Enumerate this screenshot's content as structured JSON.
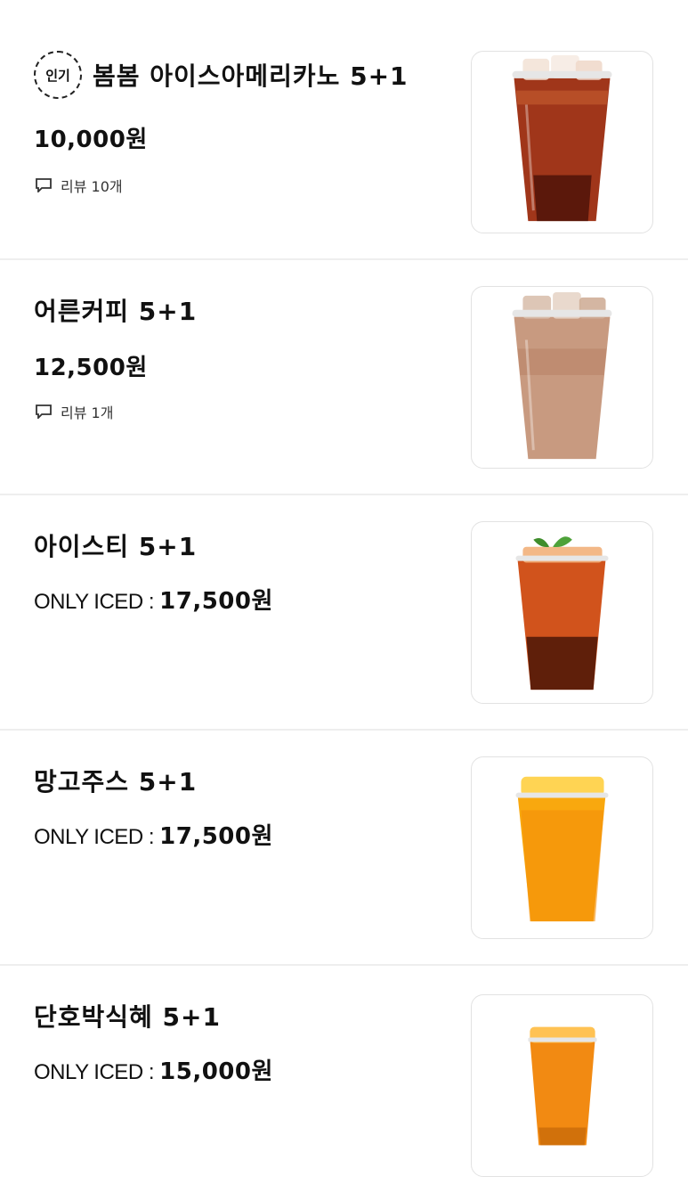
{
  "items": [
    {
      "name": "봄봄 아이스아메리카노 5+1",
      "badge": "인기",
      "price": "10,000원",
      "review": "리뷰 10개",
      "image": "iced-americano-cup"
    },
    {
      "name": "어른커피 5+1",
      "price": "12,500원",
      "review": "리뷰 1개",
      "image": "iced-latte-cup"
    },
    {
      "name": "아이스티 5+1",
      "price_label": "ONLY ICED : ",
      "price": "17,500원",
      "image": "iced-tea-cup"
    },
    {
      "name": "망고주스 5+1",
      "price_label": "ONLY ICED : ",
      "price": "17,500원",
      "image": "mango-juice-cup"
    },
    {
      "name": "단호박식혜 5+1",
      "price_label": "ONLY ICED : ",
      "price": "15,000원",
      "image": "pumpkin-sikhye-cup"
    }
  ],
  "icons": {
    "review": "speech-bubble-icon",
    "badge": "dashed-circle-icon"
  },
  "colors": {
    "divider": "#eeeeee",
    "text": "#111111",
    "thumb_border": "#e2e2e2"
  }
}
